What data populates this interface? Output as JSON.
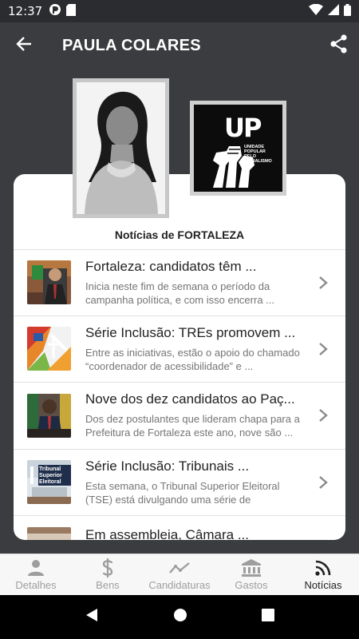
{
  "status_bar": {
    "time": "12:37",
    "icons": [
      "app-notification-icon",
      "sd-card-icon",
      "wifi-icon",
      "signal-icon",
      "battery-icon"
    ]
  },
  "app_bar": {
    "title": "PAULA COLARES",
    "back_icon": "arrow-left-icon",
    "share_icon": "share-icon"
  },
  "party": {
    "abbr": "UP",
    "name": "UNIDADE POPULAR PELO SOCIALISMO"
  },
  "news": {
    "heading": "Notícias de FORTALEZA",
    "items": [
      {
        "title": "Fortaleza: candidatos têm ...",
        "summary": "Inicia neste fim de semana o período da campanha política, e com isso encerra ..."
      },
      {
        "title": "Série Inclusão: TREs promovem ...",
        "summary": "Entre as iniciativas, estão o apoio do chamado “coordenador de acessibilidade” e ..."
      },
      {
        "title": "Nove dos dez candidatos ao Paç...",
        "summary": "Dos dez postulantes que lideram chapa para a Prefeitura de Fortaleza este ano, nove são ..."
      },
      {
        "title": "Série Inclusão: Tribunais ...",
        "summary": "Esta semana, o Tribunal Superior Eleitoral (TSE) está divulgando uma série de matérias..."
      },
      {
        "title": "Em assembleia, Câmara ...",
        "summary": ""
      }
    ],
    "thumb4_text": "Tribunal Superior Eleitoral"
  },
  "bottom_nav": {
    "items": [
      {
        "label": "Detalhes",
        "icon": "person-icon"
      },
      {
        "label": "Bens",
        "icon": "dollar-icon"
      },
      {
        "label": "Candidaturas",
        "icon": "trend-line-icon"
      },
      {
        "label": "Gastos",
        "icon": "bank-icon"
      },
      {
        "label": "Notícias",
        "icon": "rss-icon"
      }
    ],
    "active": "Notícias"
  },
  "colors": {
    "app_bar": "#3a3c3f",
    "status_bar": "#2b2c2f",
    "card": "#ffffff",
    "active_nav": "#222222",
    "inactive_nav": "#9e9e9e"
  }
}
